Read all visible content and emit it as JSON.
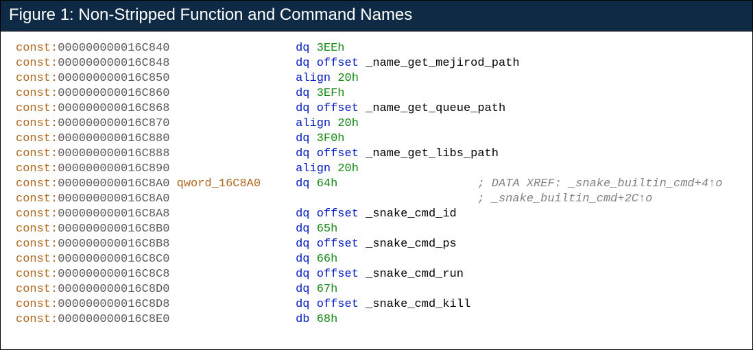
{
  "header": {
    "title": "Figure 1: Non-Stripped Function and Command Names"
  },
  "disasm": {
    "section": "const",
    "address_width": 15,
    "label_column_width": 12,
    "lines": [
      {
        "addr": "000000000016C840",
        "label": "",
        "mnemonic": "dq",
        "operand": {
          "kind": "num",
          "value": "3EEh"
        },
        "comment": ""
      },
      {
        "addr": "000000000016C848",
        "label": "",
        "mnemonic": "dq",
        "operand": {
          "kind": "offset",
          "name": "_name_get_mejirod_path"
        },
        "comment": ""
      },
      {
        "addr": "000000000016C850",
        "label": "",
        "mnemonic": "align",
        "operand": {
          "kind": "num",
          "value": "20h"
        },
        "comment": ""
      },
      {
        "addr": "000000000016C860",
        "label": "",
        "mnemonic": "dq",
        "operand": {
          "kind": "num",
          "value": "3EFh"
        },
        "comment": ""
      },
      {
        "addr": "000000000016C868",
        "label": "",
        "mnemonic": "dq",
        "operand": {
          "kind": "offset",
          "name": "_name_get_queue_path"
        },
        "comment": ""
      },
      {
        "addr": "000000000016C870",
        "label": "",
        "mnemonic": "align",
        "operand": {
          "kind": "num",
          "value": "20h"
        },
        "comment": ""
      },
      {
        "addr": "000000000016C880",
        "label": "",
        "mnemonic": "dq",
        "operand": {
          "kind": "num",
          "value": "3F0h"
        },
        "comment": ""
      },
      {
        "addr": "000000000016C888",
        "label": "",
        "mnemonic": "dq",
        "operand": {
          "kind": "offset",
          "name": "_name_get_libs_path"
        },
        "comment": ""
      },
      {
        "addr": "000000000016C890",
        "label": "",
        "mnemonic": "align",
        "operand": {
          "kind": "num",
          "value": "20h"
        },
        "comment": ""
      },
      {
        "addr": "000000000016C8A0",
        "label": "qword_16C8A0",
        "mnemonic": "dq",
        "operand": {
          "kind": "num",
          "value": "64h"
        },
        "comment": "; DATA XREF: _snake_builtin_cmd+4↑o"
      },
      {
        "addr": "000000000016C8A0",
        "label": "",
        "mnemonic": "",
        "operand": {
          "kind": "none"
        },
        "comment": "; _snake_builtin_cmd+2C↑o"
      },
      {
        "addr": "000000000016C8A8",
        "label": "",
        "mnemonic": "dq",
        "operand": {
          "kind": "offset",
          "name": "_snake_cmd_id"
        },
        "comment": ""
      },
      {
        "addr": "000000000016C8B0",
        "label": "",
        "mnemonic": "dq",
        "operand": {
          "kind": "num",
          "value": "65h"
        },
        "comment": ""
      },
      {
        "addr": "000000000016C8B8",
        "label": "",
        "mnemonic": "dq",
        "operand": {
          "kind": "offset",
          "name": "_snake_cmd_ps"
        },
        "comment": ""
      },
      {
        "addr": "000000000016C8C0",
        "label": "",
        "mnemonic": "dq",
        "operand": {
          "kind": "num",
          "value": "66h"
        },
        "comment": ""
      },
      {
        "addr": "000000000016C8C8",
        "label": "",
        "mnemonic": "dq",
        "operand": {
          "kind": "offset",
          "name": "_snake_cmd_run"
        },
        "comment": ""
      },
      {
        "addr": "000000000016C8D0",
        "label": "",
        "mnemonic": "dq",
        "operand": {
          "kind": "num",
          "value": "67h"
        },
        "comment": ""
      },
      {
        "addr": "000000000016C8D8",
        "label": "",
        "mnemonic": "dq",
        "operand": {
          "kind": "offset",
          "name": "_snake_cmd_kill"
        },
        "comment": ""
      },
      {
        "addr": "000000000016C8E0",
        "label": "",
        "mnemonic": "db",
        "operand": {
          "kind": "num",
          "value": "68h"
        },
        "comment": ""
      }
    ]
  },
  "layout": {
    "instr_column_start": 40,
    "comment_column_start": 66
  }
}
